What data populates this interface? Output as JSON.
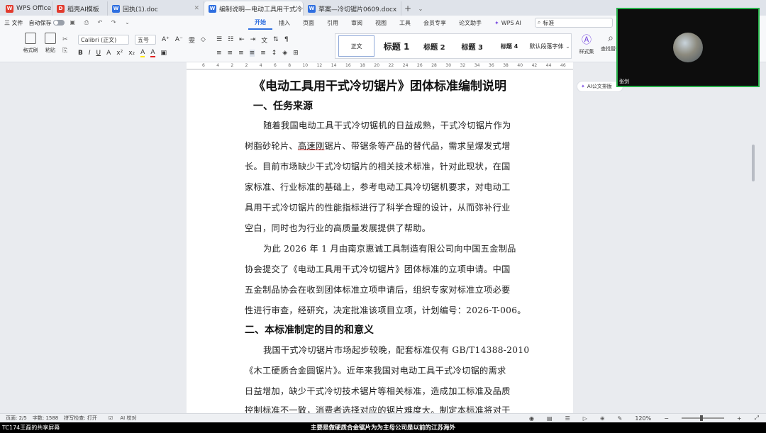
{
  "tabs": [
    {
      "label": "WPS Office",
      "color": "#e23b2e",
      "glyph": "W"
    },
    {
      "label": "稻壳AI模板",
      "color": "#e23b2e",
      "glyph": "D"
    },
    {
      "label": "回执(1).doc",
      "color": "#2f6fe0",
      "glyph": "W"
    },
    {
      "label": "编制说明—电动工具用干式冷切",
      "color": "#2f6fe0",
      "glyph": "W"
    },
    {
      "label": "草案—冷切锯片0609.docx",
      "color": "#2f6fe0",
      "glyph": "W"
    }
  ],
  "menurow": {
    "file": "三 文件",
    "autosave": "自动保存",
    "items": [
      "开始",
      "插入",
      "页面",
      "引用",
      "审阅",
      "视图",
      "工具",
      "会员专享",
      "论文助手",
      "WPS AI"
    ],
    "active_index": 0,
    "search_value": "标准"
  },
  "ribbon": {
    "format_painter": "格式刷",
    "paste": "粘贴",
    "font_name": "Calibri (正文)",
    "font_size": "五号",
    "styles": [
      "正文",
      "标题 1",
      "标题 2",
      "标题 3",
      "标题 4",
      "默认段落字体"
    ],
    "style_set": "样式集",
    "find_replace": "查找替换"
  },
  "ruler_ticks": [
    "6",
    "4",
    "2",
    "2",
    "4",
    "6",
    "8",
    "10",
    "12",
    "14",
    "16",
    "18",
    "20",
    "22",
    "24",
    "26",
    "28",
    "30",
    "32",
    "34",
    "36",
    "38",
    "40",
    "42",
    "44",
    "46"
  ],
  "document": {
    "title": "《电动工具用干式冷切锯片》团体标准编制说明",
    "heading1": "一、任务来源",
    "p1": [
      "随着我国电动工具干式冷切锯机的日益成熟，干式冷切锯片作为",
      "树脂砂轮片、",
      "高速刚",
      "锯片、带锯条等产品的替代品，需求呈爆发式增",
      "长。目前市场缺少干式冷切锯片的相关技术标准，针对此现状，在国",
      "家标准、行业标准的基础上，参考电动工具冷切锯机要求，对电动工",
      "具用干式冷切锯片的性能指标进行了科学合理的设计，从而弥补行业",
      "空白，同时也为行业的高质量发展提供了帮助。"
    ],
    "p2": [
      "为此 2026 年 1 月由南京惠诚工具制造有限公司向中国五金制品",
      "协会提交了《电动工具用干式冷切锯片》团体标准的立项申请。中国",
      "五金制品协会在收到团体标准立项申请后，组织专家对标准立项必要",
      "性进行审查，经研究，决定批准该项目立项，计划编号：2026-T-006。"
    ],
    "heading2": "二、本标准制定的目的和意义",
    "p3": [
      "我国干式冷切锯片市场起步较晚，配套标准仅有 GB/T14388-2010",
      "《木工硬质合金圆锯片》。近年来我国对电动工具干式冷切锯的需求",
      "日益增加，缺少干式冷切技术锯片等相关标准，造成加工标准及品质",
      "控制标准不一致，消费者选择对应的锯片难度大。制定本标准将对干"
    ]
  },
  "ai_bubble": "AI公文排版",
  "video": {
    "name": "张剑"
  },
  "statusbar": {
    "page": "页面: 2/5",
    "words": "字数: 1588",
    "spell": "拼写检查: 打开",
    "ai_check": "AI 校对",
    "zoom": "120%"
  },
  "bottom": {
    "share": "TC174王磊的共享屏幕",
    "subtitle": "主要是做硬质合金锯片为为主母公司是以前的江苏海外"
  }
}
